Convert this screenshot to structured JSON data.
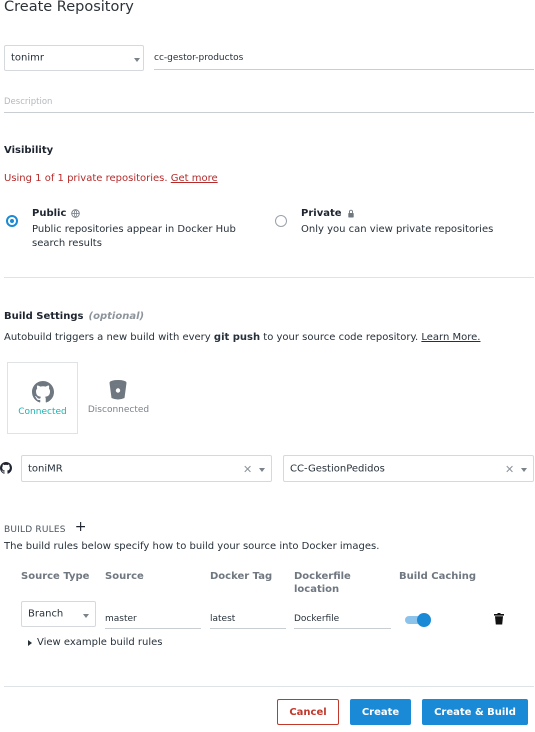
{
  "page": {
    "title": "Create Repository"
  },
  "namespace": {
    "value": "tonimr"
  },
  "repo_name": {
    "value": "cc-gestor-productos"
  },
  "description": {
    "placeholder": "Description"
  },
  "visibility": {
    "title": "Visibility",
    "warning": "Using 1 of 1 private repositories.",
    "get_more": "Get more",
    "public": {
      "label": "Public",
      "desc": "Public repositories appear in Docker Hub search results",
      "selected": true
    },
    "private": {
      "label": "Private",
      "desc": "Only you can view private repositories",
      "selected": false
    }
  },
  "build": {
    "title": "Build Settings",
    "optional": "(optional)",
    "desc_prefix": "Autobuild triggers a new build with every",
    "desc_bold": "git push",
    "desc_suffix": "to your source code repository.",
    "learn_more": "Learn More.",
    "providers": [
      {
        "name": "github-icon",
        "status": "Connected",
        "color": "#1bb3b3"
      },
      {
        "name": "bitbucket-icon",
        "status": "Disconnected",
        "color": "#7a828a"
      }
    ],
    "org": {
      "value": "toniMR"
    },
    "repo": {
      "value": "CC-GestionPedidos"
    }
  },
  "rules": {
    "title": "BUILD RULES",
    "add": "+",
    "desc": "The build rules below specify how to build your source into Docker images.",
    "columns": [
      "Source Type",
      "Source",
      "Docker Tag",
      "Dockerfile location",
      "Build Caching"
    ],
    "row": {
      "source_type": "Branch",
      "source": "master",
      "docker_tag": "latest",
      "dockerfile": "Dockerfile",
      "build_caching": true
    },
    "example": "View example build rules"
  },
  "actions": {
    "cancel": "Cancel",
    "create": "Create",
    "create_build": "Create & Build"
  },
  "colors": {
    "accent": "#1a8ad6",
    "danger": "#c0392b",
    "connected": "#1bb3b3"
  }
}
